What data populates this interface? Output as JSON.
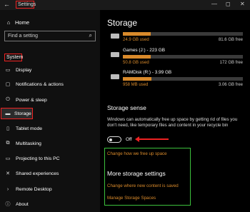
{
  "window": {
    "title": "Settings",
    "back_glyph": "←",
    "controls": [
      "—",
      "◻",
      "✕"
    ]
  },
  "sidebar": {
    "home_label": "Home",
    "search_placeholder": "Find a setting",
    "section_header": "System",
    "items": [
      {
        "label": "Display",
        "icon": "display-icon"
      },
      {
        "label": "Notifications & actions",
        "icon": "notifications-icon"
      },
      {
        "label": "Power & sleep",
        "icon": "power-icon"
      },
      {
        "label": "Storage",
        "icon": "storage-icon"
      },
      {
        "label": "Tablet mode",
        "icon": "tablet-icon"
      },
      {
        "label": "Multitasking",
        "icon": "multitasking-icon"
      },
      {
        "label": "Projecting to this PC",
        "icon": "projecting-icon"
      },
      {
        "label": "Shared experiences",
        "icon": "shared-icon"
      },
      {
        "label": "Remote Desktop",
        "icon": "remote-desktop-icon"
      },
      {
        "label": "About",
        "icon": "about-icon"
      }
    ]
  },
  "main": {
    "title": "Storage",
    "drives": [
      {
        "name": "",
        "used": "24.9 GB used",
        "free": "81.6 GB free",
        "fill": 0.23
      },
      {
        "name": "Games (J:) - 223 GB",
        "used": "50.8 GB used",
        "free": "172 GB free",
        "fill": 0.23
      },
      {
        "name": "RAMDisk (R:) - 3.99 GB",
        "used": "958 MB used",
        "free": "3.06 GB free",
        "fill": 0.24
      }
    ],
    "storage_sense_title": "Storage sense",
    "storage_sense_desc": "Windows can automatically free up space by getting rid of files you don't need, like temporary files and content in your recycle bin",
    "toggle_state": "Off",
    "link_change_free": "Change how we free up space",
    "more_title": "More storage settings",
    "link_new_content": "Change where new content is saved",
    "link_manage_spaces": "Manage Storage Spaces"
  },
  "colors": {
    "accent": "#d98a2b",
    "highlight_red": "#e22222",
    "highlight_green": "#3cc13c"
  }
}
